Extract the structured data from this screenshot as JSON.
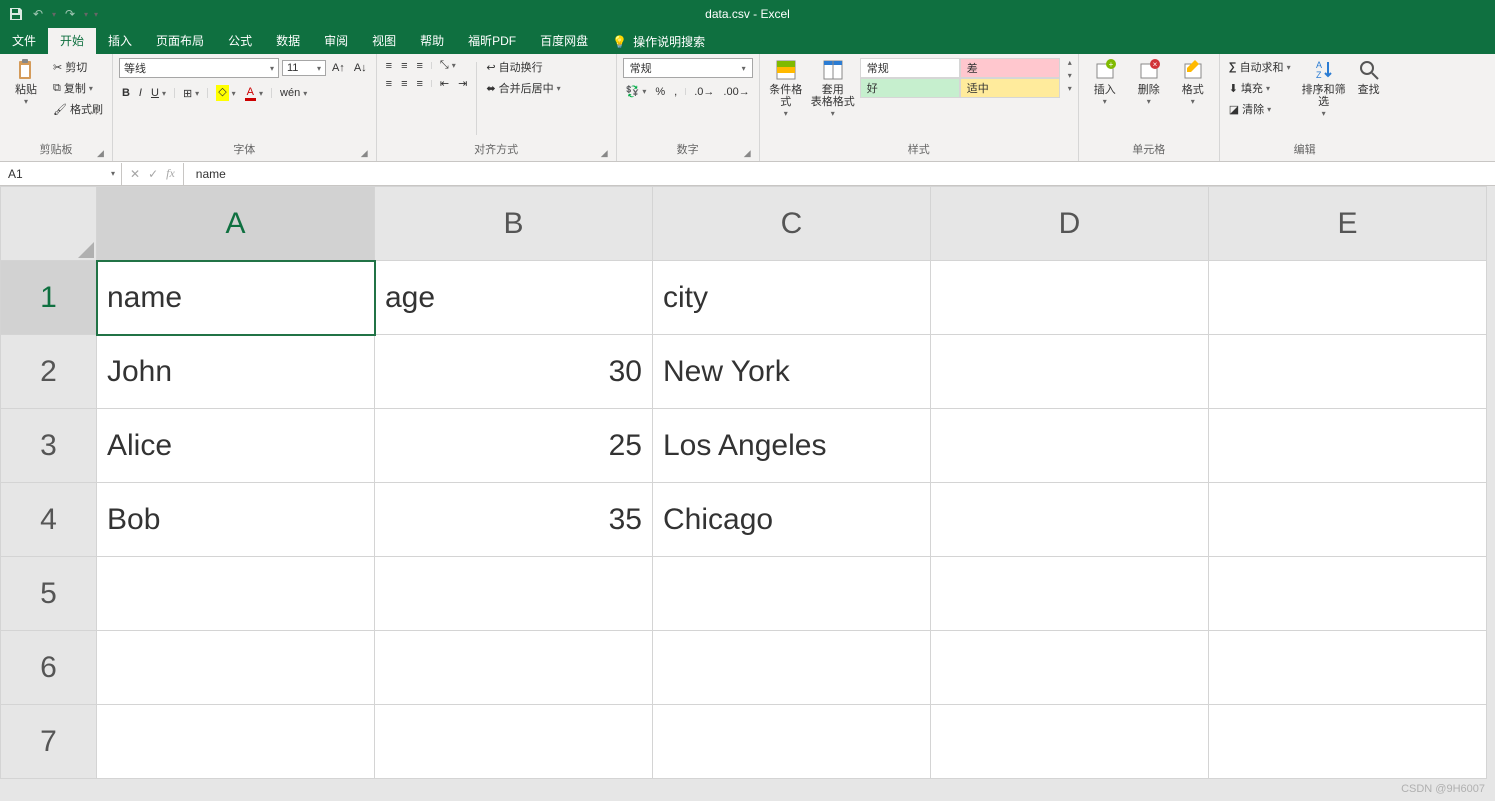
{
  "title": "data.csv  -  Excel",
  "tabs": {
    "file": "文件",
    "home": "开始",
    "insert": "插入",
    "layout": "页面布局",
    "formulas": "公式",
    "data": "数据",
    "review": "审阅",
    "view": "视图",
    "help": "帮助",
    "foxit": "福昕PDF",
    "baidu": "百度网盘",
    "tellme": "操作说明搜索"
  },
  "clipboard": {
    "paste": "粘贴",
    "cut": "剪切",
    "copy": "复制",
    "painter": "格式刷",
    "group": "剪贴板"
  },
  "font": {
    "name": "等线",
    "size": "11",
    "group": "字体"
  },
  "align": {
    "wrap": "自动换行",
    "merge": "合并后居中",
    "group": "对齐方式"
  },
  "number": {
    "format": "常规",
    "group": "数字"
  },
  "styles": {
    "cond": "条件格式",
    "table": "套用\n表格格式",
    "normal": "常规",
    "bad": "差",
    "good": "好",
    "neutral": "适中",
    "group": "样式"
  },
  "cells": {
    "insert": "插入",
    "delete": "删除",
    "format": "格式",
    "group": "单元格"
  },
  "editing": {
    "sum": "自动求和",
    "fill": "填充",
    "clear": "清除",
    "sort": "排序和筛选",
    "find": "查找",
    "group": "编辑"
  },
  "formula_bar": {
    "namebox": "A1",
    "value": "name"
  },
  "sheet": {
    "columns": [
      "A",
      "B",
      "C",
      "D",
      "E"
    ],
    "rows": [
      "1",
      "2",
      "3",
      "4",
      "5",
      "6",
      "7"
    ],
    "data": [
      [
        "name",
        "age",
        "city",
        "",
        ""
      ],
      [
        "John",
        "30",
        "New York",
        "",
        ""
      ],
      [
        "Alice",
        "25",
        "Los Angeles",
        "",
        ""
      ],
      [
        "Bob",
        "35",
        "Chicago",
        "",
        ""
      ],
      [
        "",
        "",
        "",
        "",
        ""
      ],
      [
        "",
        "",
        "",
        "",
        ""
      ],
      [
        "",
        "",
        "",
        "",
        ""
      ]
    ],
    "numeric_cols": [
      1
    ],
    "selected": {
      "row": 0,
      "col": 0
    }
  },
  "watermark": "CSDN @9H6007"
}
